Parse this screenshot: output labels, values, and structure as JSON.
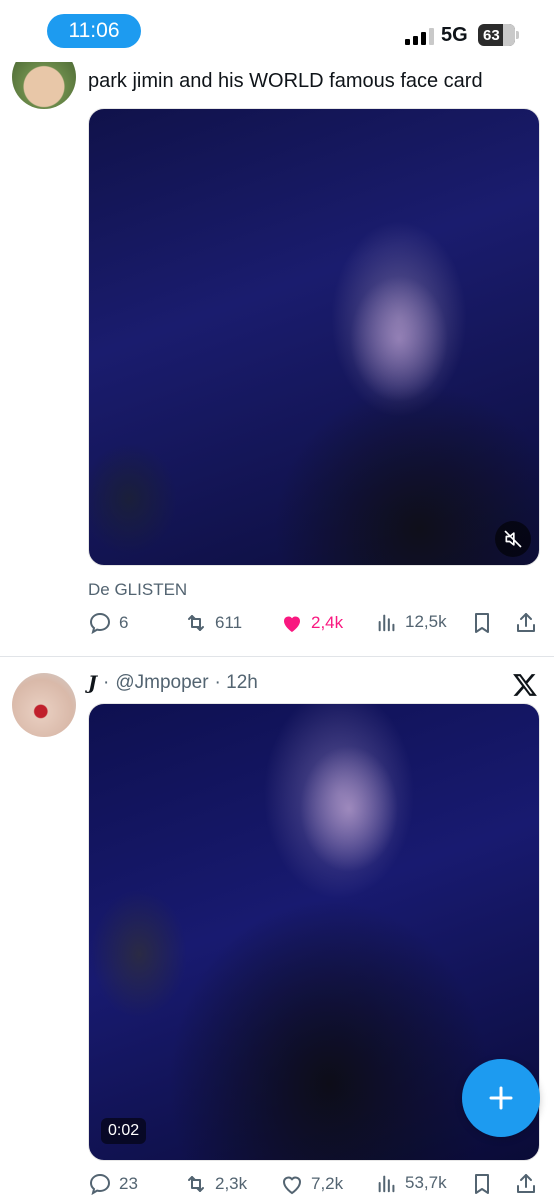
{
  "status_bar": {
    "time": "11:06",
    "network": "5G",
    "battery": "63"
  },
  "tweet1": {
    "text": "park jimin and his WORLD famous face card",
    "source": "De GLISTEN",
    "replies": "6",
    "retweets": "611",
    "likes": "2,4k",
    "views": "12,5k",
    "liked": true,
    "media_icon": "muted-speaker-icon"
  },
  "tweet2": {
    "name": "J",
    "separator": "·",
    "handle": "@Jmpoper",
    "time": "· 12h",
    "video_duration": "0:02",
    "replies": "23",
    "retweets": "2,3k",
    "likes": "7,2k",
    "views": "53,7k"
  },
  "colors": {
    "accent": "#1d9bf0",
    "like": "#f91880",
    "muted_text": "#536471"
  },
  "fab": {
    "icon": "plus-icon"
  }
}
